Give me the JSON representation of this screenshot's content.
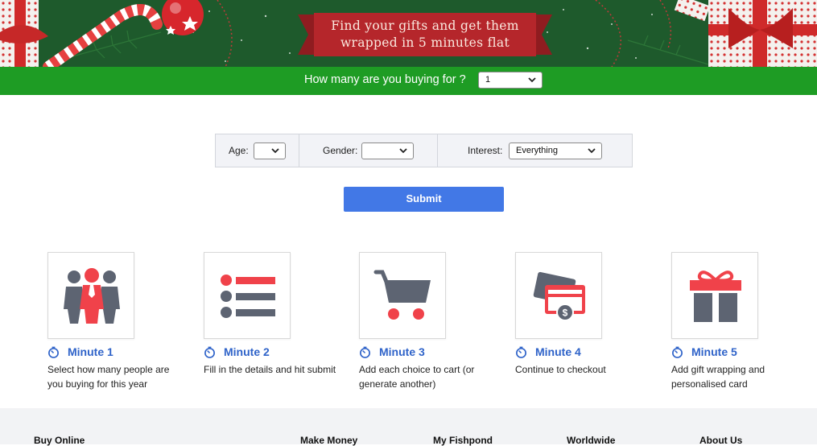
{
  "banner": {
    "tagline_line1": "Find your gifts and get them",
    "tagline_line2": "wrapped in 5 minutes flat"
  },
  "count_bar": {
    "label": "How many are you buying for ?",
    "selected": "1"
  },
  "filters": {
    "age_label": "Age:",
    "age_value": "",
    "gender_label": "Gender:",
    "gender_value": "",
    "interest_label": "Interest:",
    "interest_value": "Everything"
  },
  "submit_label": "Submit",
  "steps": [
    {
      "title": "Minute 1",
      "desc": "Select how many people are you buying for this year",
      "icon": "people-icon"
    },
    {
      "title": "Minute 2",
      "desc": "Fill in the details and hit submit",
      "icon": "list-icon"
    },
    {
      "title": "Minute 3",
      "desc": "Add each choice to cart (or generate another)",
      "icon": "cart-icon"
    },
    {
      "title": "Minute 4",
      "desc": "Continue to checkout",
      "icon": "payment-card-icon"
    },
    {
      "title": "Minute 5",
      "desc": "Add gift wrapping and personalised card",
      "icon": "gift-icon"
    }
  ],
  "footer": {
    "columns": [
      "Buy Online",
      "Make Money",
      "My Fishpond",
      "Worldwide",
      "About Us"
    ]
  },
  "colors": {
    "banner_green": "#1e5a2c",
    "bar_green": "#1e9c24",
    "ribbon_red": "#b5262b",
    "accent_blue": "#4278e6",
    "step_title_blue": "#2f63c9",
    "icon_grey": "#5d6472",
    "icon_red": "#f0424a"
  }
}
